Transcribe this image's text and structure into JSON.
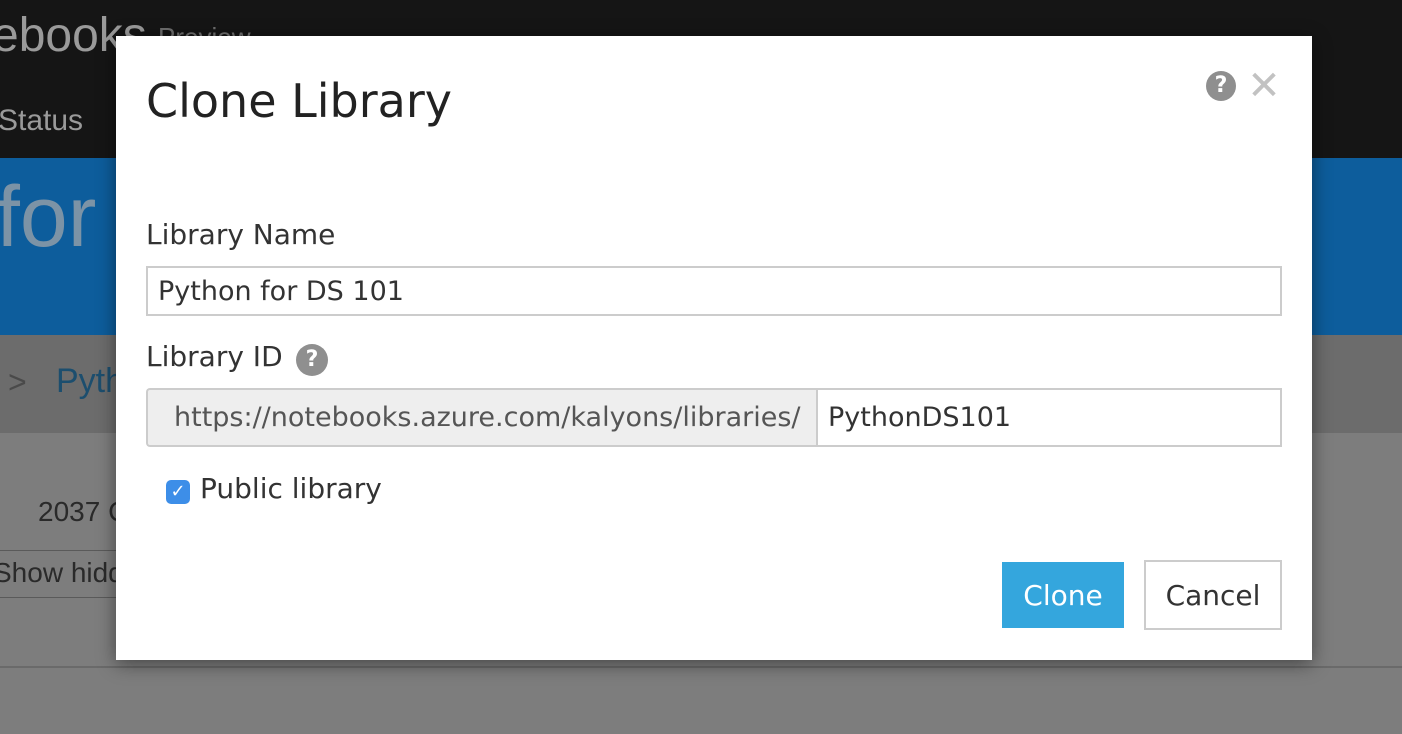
{
  "background": {
    "brand": "ebooks",
    "brand_sub": "Preview",
    "nav_status": "Status",
    "hero_text": "for",
    "crumb_separator": ">",
    "crumb_link": "Pyth",
    "count_text": "2037 C",
    "show_hidden_label": "Show hidden"
  },
  "dialog": {
    "title": "Clone Library",
    "help_icon": "question-circle-icon",
    "close_icon": "close-x-icon",
    "library_name_label": "Library Name",
    "library_name_value": "Python for DS 101",
    "library_id_label": "Library ID",
    "library_id_prefix": "https://notebooks.azure.com/kalyons/libraries/",
    "library_id_value": "PythonDS101",
    "public_checkbox_checked": true,
    "public_label": "Public library",
    "clone_button": "Clone",
    "cancel_button": "Cancel"
  },
  "colors": {
    "accent_blue": "#34a6dd",
    "checkbox_blue": "#3d8ee8",
    "hero_blue": "#0d5d9c",
    "topbar": "#151515"
  }
}
